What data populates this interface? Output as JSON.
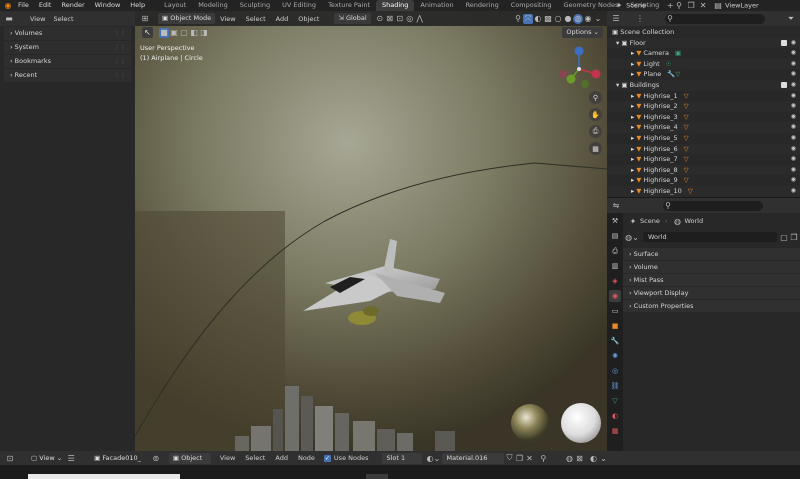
{
  "topbar": {
    "menus": [
      "File",
      "Edit",
      "Render",
      "Window",
      "Help"
    ],
    "workspaces": [
      "Layout",
      "Modeling",
      "Sculpting",
      "UV Editing",
      "Texture Paint",
      "Shading",
      "Animation",
      "Rendering",
      "Compositing",
      "Geometry Nodes",
      "Scripting"
    ],
    "active_workspace": "Shading",
    "scene": "Scene",
    "view_layer": "ViewLayer"
  },
  "left_panel": {
    "view": "View",
    "select": "Select",
    "items": [
      "Volumes",
      "System",
      "Bookmarks",
      "Recent"
    ]
  },
  "viewport": {
    "mode": "Object Mode",
    "menus": [
      "View",
      "Select",
      "Add",
      "Object"
    ],
    "transform": "Global",
    "options": "Options",
    "perspective": "User Perspective",
    "active_object": "(1) Airplane | Circle"
  },
  "outliner": {
    "root": "Scene Collection",
    "floor": "Floor",
    "floor_items": [
      "Camera",
      "Light",
      "Plane"
    ],
    "buildings": "Buildings",
    "building_items": [
      "Highrise_1",
      "Highrise_2",
      "Highrise_3",
      "Highrise_4",
      "Highrise_5",
      "Highrise_6",
      "Highrise_7",
      "Highrise_8",
      "Highrise_9",
      "Highrise_10"
    ]
  },
  "properties": {
    "scene": "Scene",
    "world": "World",
    "world_field": "World",
    "panels": [
      "Surface",
      "Volume",
      "Mist Pass",
      "Viewport Display",
      "Custom Properties"
    ]
  },
  "node_header": {
    "view": "View",
    "image": "Facade010_",
    "object": "Object",
    "menus": [
      "View",
      "Select",
      "Add",
      "Node"
    ],
    "use_nodes": "Use Nodes",
    "slot": "Slot 1",
    "material": "Material.016"
  },
  "colors": {
    "accent": "#4772b3",
    "orange": "#e88a2a",
    "green": "#3ea67a"
  }
}
